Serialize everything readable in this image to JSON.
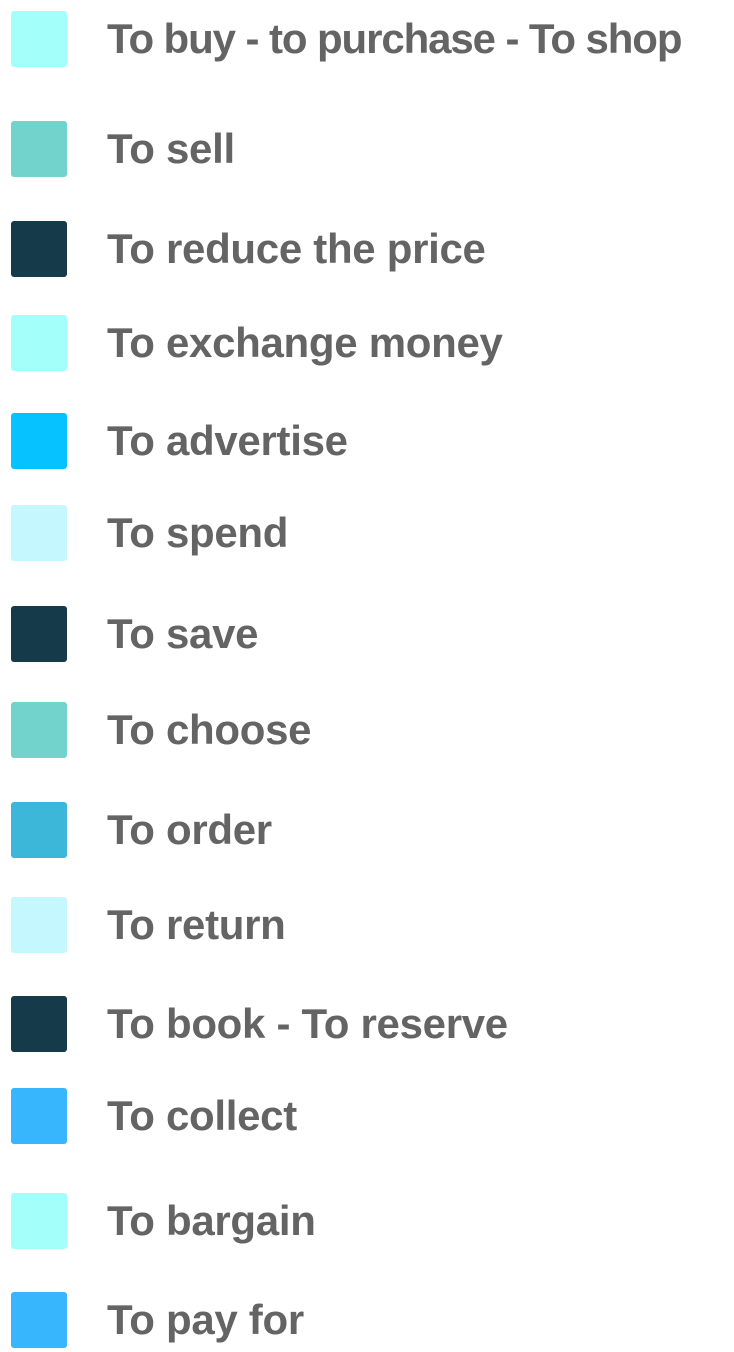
{
  "items": [
    {
      "label": "To buy - to purchase - To shop",
      "color": "#a2fffa"
    },
    {
      "label": "To sell",
      "color": "#72d3cd"
    },
    {
      "label": "To reduce the price",
      "color": "#153a49"
    },
    {
      "label": "To exchange money",
      "color": "#a2fffa"
    },
    {
      "label": "To advertise",
      "color": "#06c2ff"
    },
    {
      "label": "To spend",
      "color": "#c4f8fe"
    },
    {
      "label": "To save",
      "color": "#153a49"
    },
    {
      "label": "To choose",
      "color": "#72d3cd"
    },
    {
      "label": "To order",
      "color": "#3db7d9"
    },
    {
      "label": "To return",
      "color": "#c4f8fe"
    },
    {
      "label": "To book - To reserve",
      "color": "#153a49"
    },
    {
      "label": "To collect",
      "color": "#37b6fe"
    },
    {
      "label": "To bargain",
      "color": "#a2fffa"
    },
    {
      "label": "To pay for",
      "color": "#37b6fe"
    }
  ]
}
